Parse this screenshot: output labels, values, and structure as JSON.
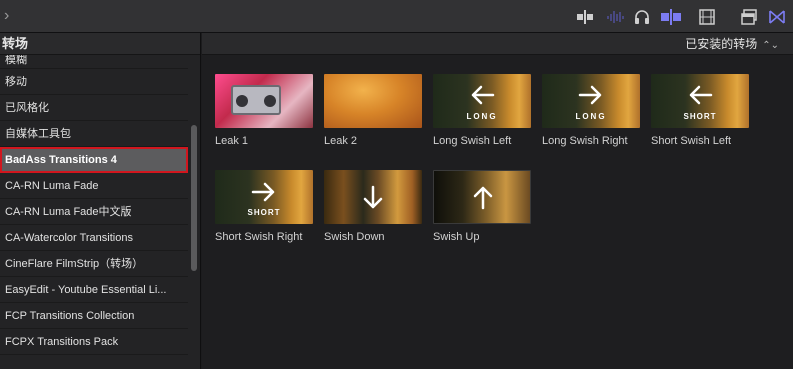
{
  "toolbar": {
    "back_glyph": "›",
    "icons": [
      "clip-trim-icon",
      "audio-waveform-icon",
      "headphones-icon",
      "snap-icon",
      "filmstrip-icon",
      "window-layout-icon",
      "transitions-browser-icon"
    ],
    "accent_color": "#7c7cf2"
  },
  "sidebar": {
    "title": "转场",
    "items": [
      {
        "label": "模糊"
      },
      {
        "label": "移动"
      },
      {
        "label": "已风格化"
      },
      {
        "label": "自媒体工具包"
      },
      {
        "label": "BadAss Transitions 4",
        "selected": true
      },
      {
        "label": "CA-RN Luma Fade"
      },
      {
        "label": "CA-RN Luma Fade中文版"
      },
      {
        "label": "CA-Watercolor Transitions"
      },
      {
        "label": "CineFlare FilmStrip（转场）"
      },
      {
        "label": "EasyEdit - Youtube Essential Li..."
      },
      {
        "label": "FCP Transitions Collection"
      },
      {
        "label": "FCPX Transitions Pack"
      }
    ]
  },
  "main": {
    "filter_label": "已安装的转场",
    "sort_glyph": "⌃⌄",
    "tiles": [
      {
        "label": "Leak 1",
        "overlay_text": ""
      },
      {
        "label": "Leak 2",
        "overlay_text": ""
      },
      {
        "label": "Long Swish Left",
        "overlay_text": "LONG"
      },
      {
        "label": "Long Swish Right",
        "overlay_text": "LONG"
      },
      {
        "label": "Short Swish Left",
        "overlay_text": "SHORT"
      },
      {
        "label": "Short Swish Right",
        "overlay_text": "SHORT"
      },
      {
        "label": "Swish Down",
        "overlay_text": ""
      },
      {
        "label": "Swish Up",
        "overlay_text": ""
      }
    ]
  }
}
